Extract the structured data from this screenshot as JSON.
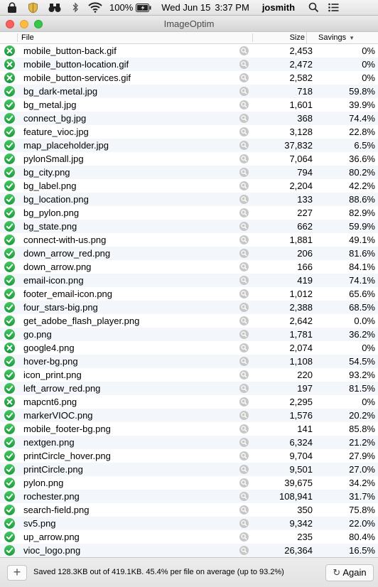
{
  "menubar": {
    "battery_percent": "100%",
    "date": "Wed Jun 15",
    "time": "3:37 PM",
    "user": "josmith",
    "icons": [
      "lock-icon",
      "shield-icon",
      "binoculars-icon",
      "bluetooth-icon",
      "wifi-icon",
      "battery-icon",
      "search-icon",
      "list-icon"
    ]
  },
  "window": {
    "title": "ImageOptim"
  },
  "columns": {
    "file": "File",
    "size": "Size",
    "savings": "Savings"
  },
  "rows": [
    {
      "name": "mobile_button-back.gif",
      "size": "2,453",
      "savings": "0%",
      "status": "fail"
    },
    {
      "name": "mobile_button-location.gif",
      "size": "2,472",
      "savings": "0%",
      "status": "fail"
    },
    {
      "name": "mobile_button-services.gif",
      "size": "2,582",
      "savings": "0%",
      "status": "fail"
    },
    {
      "name": "bg_dark-metal.jpg",
      "size": "718",
      "savings": "59.8%",
      "status": "ok"
    },
    {
      "name": "bg_metal.jpg",
      "size": "1,601",
      "savings": "39.9%",
      "status": "ok"
    },
    {
      "name": "connect_bg.jpg",
      "size": "368",
      "savings": "74.4%",
      "status": "ok"
    },
    {
      "name": "feature_vioc.jpg",
      "size": "3,128",
      "savings": "22.8%",
      "status": "ok"
    },
    {
      "name": "map_placeholder.jpg",
      "size": "37,832",
      "savings": "6.5%",
      "status": "ok"
    },
    {
      "name": "pylonSmall.jpg",
      "size": "7,064",
      "savings": "36.6%",
      "status": "ok"
    },
    {
      "name": "bg_city.png",
      "size": "794",
      "savings": "80.2%",
      "status": "ok"
    },
    {
      "name": "bg_label.png",
      "size": "2,204",
      "savings": "42.2%",
      "status": "ok"
    },
    {
      "name": "bg_location.png",
      "size": "133",
      "savings": "88.6%",
      "status": "ok"
    },
    {
      "name": "bg_pylon.png",
      "size": "227",
      "savings": "82.9%",
      "status": "ok"
    },
    {
      "name": "bg_state.png",
      "size": "662",
      "savings": "59.9%",
      "status": "ok"
    },
    {
      "name": "connect-with-us.png",
      "size": "1,881",
      "savings": "49.1%",
      "status": "ok"
    },
    {
      "name": "down_arrow_red.png",
      "size": "206",
      "savings": "81.6%",
      "status": "ok"
    },
    {
      "name": "down_arrow.png",
      "size": "166",
      "savings": "84.1%",
      "status": "ok"
    },
    {
      "name": "email-icon.png",
      "size": "419",
      "savings": "74.1%",
      "status": "ok"
    },
    {
      "name": "footer_email-icon.png",
      "size": "1,012",
      "savings": "65.6%",
      "status": "ok"
    },
    {
      "name": "four_stars-big.png",
      "size": "2,388",
      "savings": "68.5%",
      "status": "ok"
    },
    {
      "name": "get_adobe_flash_player.png",
      "size": "2,642",
      "savings": "0.0%",
      "status": "ok"
    },
    {
      "name": "go.png",
      "size": "1,781",
      "savings": "36.2%",
      "status": "ok"
    },
    {
      "name": "google4.png",
      "size": "2,074",
      "savings": "0%",
      "status": "fail"
    },
    {
      "name": "hover-bg.png",
      "size": "1,108",
      "savings": "54.5%",
      "status": "ok"
    },
    {
      "name": "icon_print.png",
      "size": "220",
      "savings": "93.2%",
      "status": "ok"
    },
    {
      "name": "left_arrow_red.png",
      "size": "197",
      "savings": "81.5%",
      "status": "ok"
    },
    {
      "name": "mapcnt6.png",
      "size": "2,295",
      "savings": "0%",
      "status": "fail"
    },
    {
      "name": "markerVIOC.png",
      "size": "1,576",
      "savings": "20.2%",
      "status": "ok"
    },
    {
      "name": "mobile_footer-bg.png",
      "size": "141",
      "savings": "85.8%",
      "status": "ok"
    },
    {
      "name": "nextgen.png",
      "size": "6,324",
      "savings": "21.2%",
      "status": "ok"
    },
    {
      "name": "printCircle_hover.png",
      "size": "9,704",
      "savings": "27.9%",
      "status": "ok"
    },
    {
      "name": "printCircle.png",
      "size": "9,501",
      "savings": "27.0%",
      "status": "ok"
    },
    {
      "name": "pylon.png",
      "size": "39,675",
      "savings": "34.2%",
      "status": "ok"
    },
    {
      "name": "rochester.png",
      "size": "108,941",
      "savings": "31.7%",
      "status": "ok"
    },
    {
      "name": "search-field.png",
      "size": "350",
      "savings": "75.8%",
      "status": "ok"
    },
    {
      "name": "sv5.png",
      "size": "9,342",
      "savings": "22.0%",
      "status": "ok"
    },
    {
      "name": "up_arrow.png",
      "size": "235",
      "savings": "80.4%",
      "status": "ok"
    },
    {
      "name": "vioc_logo.png",
      "size": "26,364",
      "savings": "16.5%",
      "status": "ok"
    }
  ],
  "footer": {
    "add_label": "+",
    "summary": "Saved 128.3KB out of 419.1KB. 45.4% per file on average (up to 93.2%)",
    "again_label": "Again"
  },
  "colors": {
    "status_ok": "#28a745",
    "status_fail": "#28a745",
    "row_alt": "#f3f6fa"
  }
}
